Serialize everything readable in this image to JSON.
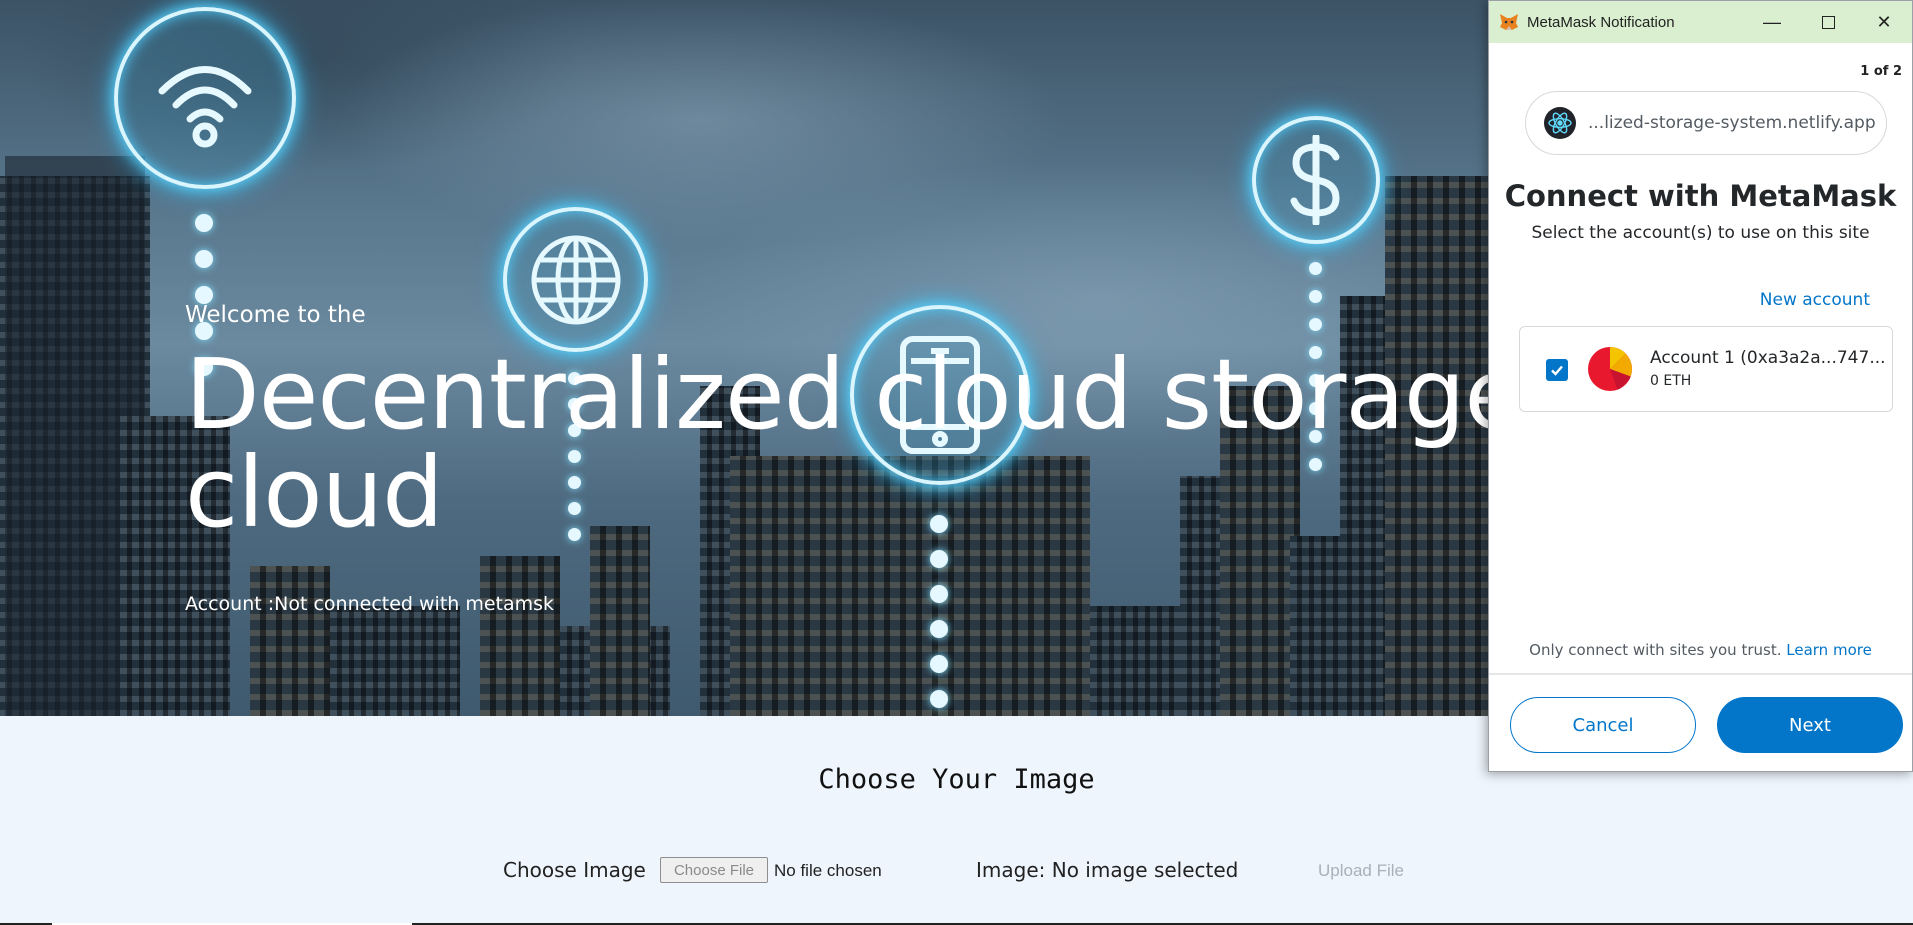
{
  "hero": {
    "welcome": "Welcome to the",
    "headline_line1": "Decentralized cloud storage",
    "headline_line2": "cloud",
    "account_text": "Account :Not connected with metamsk",
    "icons": [
      "wifi-icon",
      "globe-icon",
      "phone-icon",
      "dollar-icon"
    ]
  },
  "upload": {
    "title": "Choose Your Image",
    "choose_label": "Choose Image",
    "file_button": "Choose File",
    "no_file": "No file chosen",
    "image_status": "Image: No image selected",
    "upload_button": "Upload File"
  },
  "metamask": {
    "window_title": "MetaMask Notification",
    "pager": "1 of 2",
    "site_url": "...lized-storage-system.netlify.app",
    "heading": "Connect with MetaMask",
    "subheading": "Select the account(s) to use on this site",
    "new_account": "New account",
    "account_name": "Account 1 (0xa3a2a...747...",
    "account_balance": "0 ETH",
    "account_checked": true,
    "trust_text": "Only connect with sites you trust.",
    "learn_more": "Learn more",
    "cancel": "Cancel",
    "next": "Next",
    "colors": {
      "primary": "#0376c9",
      "title_bar": "#d9efcf"
    }
  }
}
